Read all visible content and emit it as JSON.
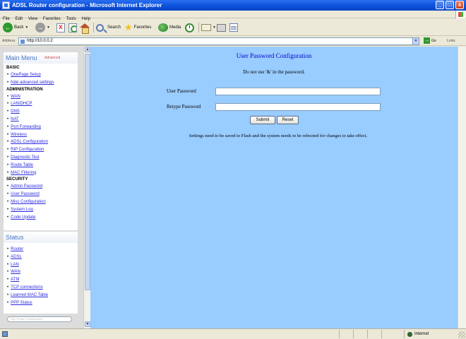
{
  "window": {
    "title": "ADSL Router configuration - Microsoft Internet Explorer",
    "controls": [
      "_",
      "□",
      "x"
    ]
  },
  "menubar": [
    "File",
    "Edit",
    "View",
    "Favorites",
    "Tools",
    "Help"
  ],
  "toolbar": {
    "back": "Back",
    "search": "Search",
    "favorites": "Favorites",
    "media": "Media"
  },
  "addressbar": {
    "label": "Address",
    "url": "http://10.0.0.2",
    "go": "Go",
    "links": "Links"
  },
  "sidebar": {
    "menu_title": "Main Menu",
    "menu_note": "Advanced",
    "basic_title": "BASIC",
    "basic_items": [
      "OnePage Setup",
      "hide advanced settings"
    ],
    "admin_title": "ADMINISTRATION",
    "admin_items": [
      "WAN",
      "LAN/DHCP",
      "DNS",
      "NAT",
      "Port Forwarding",
      "Wireless",
      "ADSL Configuration",
      "RIP Configuration",
      "Diagnostic Test",
      "Route Table",
      "MAC Filtering"
    ],
    "security_title": "SECURITY",
    "security_items": [
      "Admin Password",
      "User Password",
      "Misc Configuration",
      "System Log",
      "Code Update"
    ],
    "status_title": "Status",
    "status_items": [
      "Router",
      "ADSL",
      "LAN",
      "WAN",
      "ATM",
      "TCP connections",
      "Learned MAC Table",
      "PPP Status"
    ],
    "bottom_pill": "DSL Router Configuration"
  },
  "main": {
    "heading": "User Password Configuration",
    "note": "Do not use '&' in the password.",
    "user_password_label": "User Password",
    "retype_password_label": "Retype Password",
    "submit": "Submit",
    "reset": "Reset",
    "hint": "Settings need to be saved to Flash and the system needs to be rebooted for changes to take effect."
  },
  "statusbar": {
    "zone": "Internet"
  }
}
